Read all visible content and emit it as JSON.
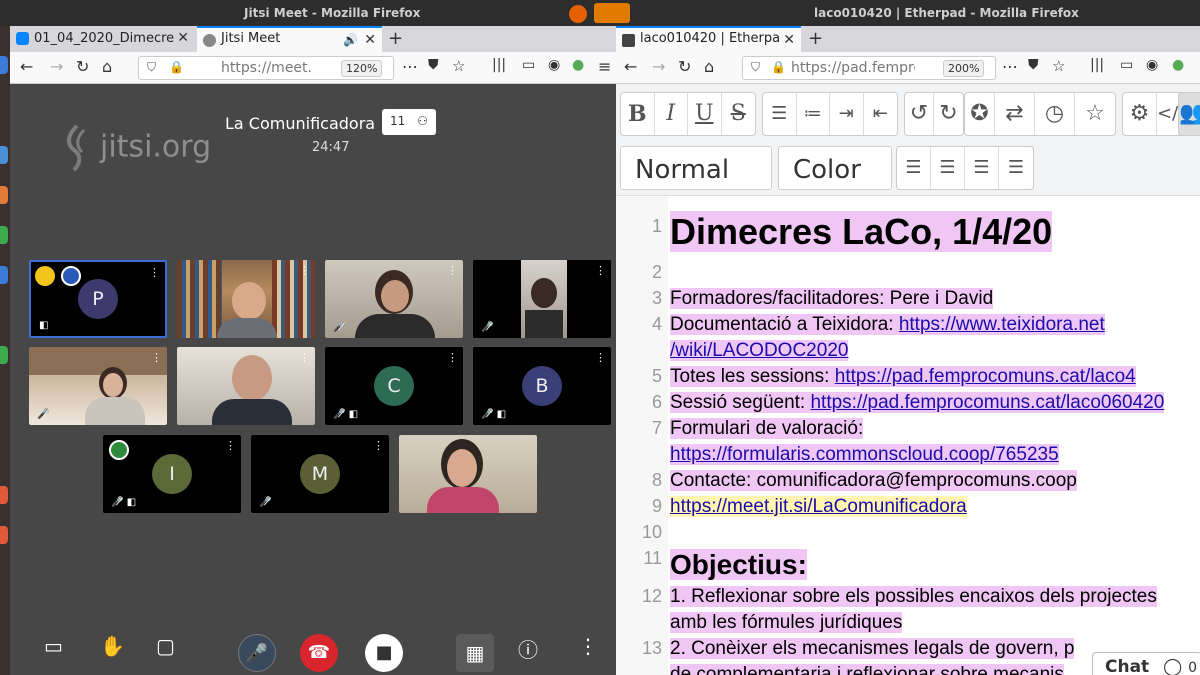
{
  "topbar": {
    "left_window_title": "Jitsi Meet - Mozilla Firefox",
    "right_window_title": "laco010420 | Etherpad - Mozilla Firefox"
  },
  "left_browser": {
    "tabs": [
      {
        "label": "01_04_2020_Dimecre"
      },
      {
        "label": "Jitsi Meet"
      }
    ],
    "url": "https://meet.j",
    "zoom": "120%"
  },
  "jitsi": {
    "logo_text": "jitsi.org",
    "meeting_title": "La Comunificadora",
    "timer": "24:47",
    "participant_count": "11",
    "avatars": [
      {
        "initial": "P",
        "color": "#3f3a6e"
      },
      {
        "initial": "C",
        "color": "#2e6b55"
      },
      {
        "initial": "B",
        "color": "#3a3f78"
      },
      {
        "initial": "I",
        "color": "#5c6a3a"
      },
      {
        "initial": "M",
        "color": "#5b5f36"
      }
    ]
  },
  "right_browser": {
    "tabs": [
      {
        "label": "laco010420 | Etherpa"
      }
    ],
    "url": "https://pad.fempro",
    "zoom": "200%"
  },
  "etherpad": {
    "paragraph_style": "Normal",
    "color_label": "Color",
    "line_numbers": [
      "1",
      "2",
      "3",
      "4",
      "5",
      "6",
      "7",
      "8",
      "9",
      "10",
      "11",
      "12",
      "13"
    ],
    "lines": {
      "l1": "Dimecres LaCo, 1/4/20",
      "l3": "Formadores/facilitadores: Pere i David",
      "l4a": "Documentació a Teixidora: ",
      "l4b": "https://www.teixidora.net",
      "l4c": "/wiki/LACODOC2020",
      "l5a": "Totes les sessions: ",
      "l5b": "https://pad.femprocomuns.cat/laco4",
      "l6a": "Sessió següent: ",
      "l6b": "https://pad.femprocomuns.cat/laco060420",
      "l7a": "Formulari de valoració: ",
      "l7b": "https://formularis.commonscloud.coop/765235",
      "l8": "Contacte: comunificadora@femprocomuns.coop",
      "l9": "https://meet.jit.si/LaComunificadora",
      "l11": "Objectius:",
      "l12a": "1. Reflexionar sobre els possibles encaixos dels projectes",
      "l12b": "amb les fórmules jurídiques",
      "l13a": "2. Conèixer els mecanismes legals de govern, p",
      "l13b": "de complementaria i reflexionar sobre mecanis"
    },
    "chat_label": "Chat",
    "chat_count": "0"
  }
}
